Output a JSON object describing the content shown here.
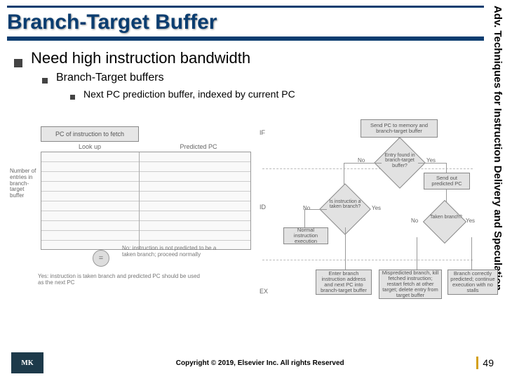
{
  "side_label": "Adv. Techniques for Instruction Delivery and Speculation",
  "title": "Branch-Target Buffer",
  "bullets": {
    "l0": "Need high instruction bandwidth",
    "l1": "Branch-Target buffers",
    "l2": "Next PC prediction buffer, indexed by current PC"
  },
  "diagram": {
    "table_header_pc": "PC of instruction to fetch",
    "col_lookup": "Look up",
    "col_predicted": "Predicted PC",
    "entries_label": "Number of entries in branch-target buffer",
    "match_symbol": "=",
    "no_text": "No: instruction is not predicted to be a taken branch; proceed normally",
    "yes_text": "Yes: instruction is taken branch and predicted PC should be used as the next PC",
    "flow": {
      "top_box": "Send PC to memory and branch-target buffer",
      "d1": "Entry found in branch-target buffer?",
      "d1_no": "No",
      "d1_yes": "Yes",
      "send_pred": "Send out predicted PC",
      "d2": "Is instruction a taken branch?",
      "d2_no": "No",
      "d2_yes": "Yes",
      "d3": "Taken branch?",
      "d3_no": "No",
      "d3_yes": "Yes",
      "normal_exec": "Normal instruction execution",
      "ex1": "Enter branch instruction address and next PC into branch-target buffer",
      "ex2": "Mispredicted branch, kill fetched instruction; restart fetch at other target; delete entry from target buffer",
      "ex3": "Branch correctly predicted; continue execution with no stalls",
      "stage_if": "IF",
      "stage_id": "ID",
      "stage_ex": "EX"
    }
  },
  "footer": {
    "logo": "MK",
    "copyright": "Copyright © 2019, Elsevier Inc. All rights Reserved",
    "page": "49"
  }
}
